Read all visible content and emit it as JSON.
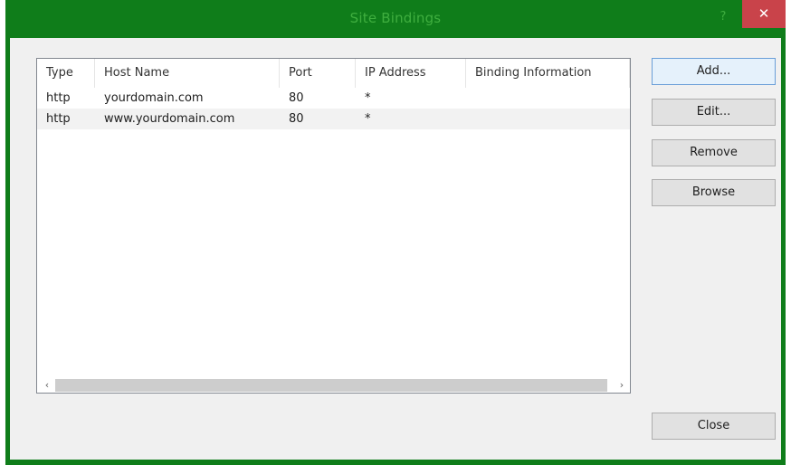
{
  "window": {
    "title": "Site Bindings",
    "help_glyph": "?",
    "close_glyph": "✕"
  },
  "columns": [
    "Type",
    "Host Name",
    "Port",
    "IP Address",
    "Binding Information"
  ],
  "rows": [
    {
      "type": "http",
      "host": "yourdomain.com",
      "port": "80",
      "ip": "*",
      "binding": ""
    },
    {
      "type": "http",
      "host": "www.yourdomain.com",
      "port": "80",
      "ip": "*",
      "binding": ""
    }
  ],
  "scrollbar": {
    "left_glyph": "‹",
    "right_glyph": "›"
  },
  "buttons": {
    "add": "Add...",
    "edit": "Edit...",
    "remove": "Remove",
    "browse": "Browse",
    "close": "Close"
  },
  "colors": {
    "frame": "#0f7d1a",
    "title_text": "#3fae3f",
    "close_button": "#c9434a"
  }
}
